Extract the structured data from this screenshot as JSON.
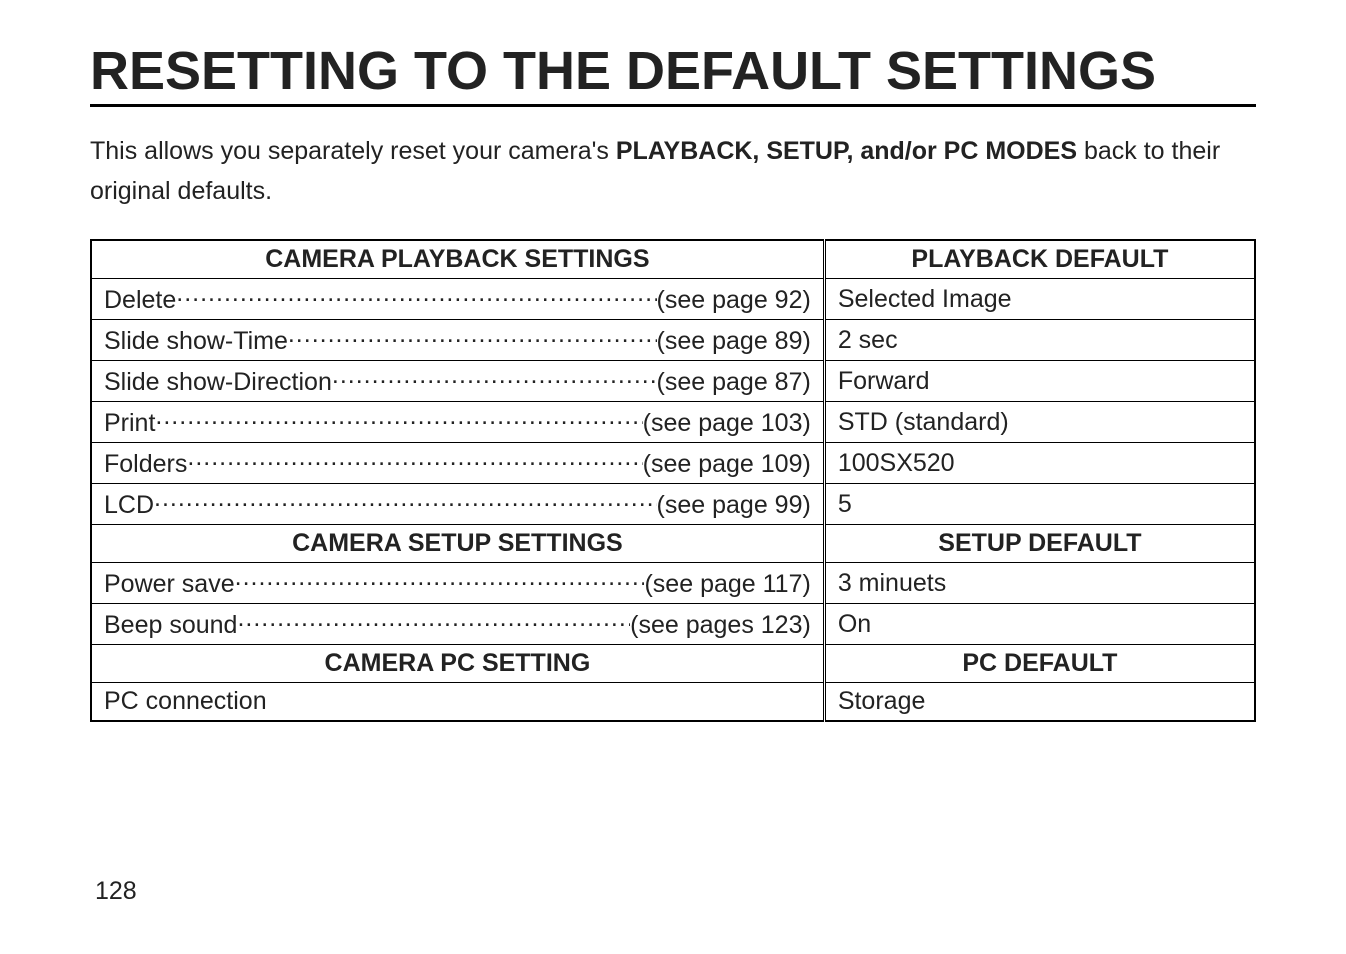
{
  "page_title": "RESETTING TO THE DEFAULT SETTINGS",
  "intro_pre": "This allows you separately reset your camera's ",
  "intro_bold": "PLAYBACK, SETUP, and/or PC MODES",
  "intro_post": " back to their original defaults.",
  "headers": {
    "playback_settings": "CAMERA PLAYBACK SETTINGS",
    "playback_default": "PLAYBACK DEFAULT",
    "setup_settings": "CAMERA SETUP SETTINGS",
    "setup_default": "SETUP DEFAULT",
    "pc_setting": "CAMERA PC SETTING",
    "pc_default": "PC DEFAULT"
  },
  "playback_rows": [
    {
      "label": "Delete ",
      "ref": "(see page 92)",
      "default": "Selected Image"
    },
    {
      "label": "Slide show-Time ",
      "ref": "(see page 89)",
      "default": "2 sec"
    },
    {
      "label": "Slide show-Direction ",
      "ref": "(see page 87)",
      "default": "Forward"
    },
    {
      "label": "Print ",
      "ref": "(see page 103)",
      "default": "STD (standard)"
    },
    {
      "label": "Folders ",
      "ref": "(see page 109)",
      "default": "100SX520"
    },
    {
      "label": "LCD ",
      "ref": "(see page 99)",
      "default": "5"
    }
  ],
  "setup_rows": [
    {
      "label": "Power save ",
      "ref": "(see page 117)",
      "default": "3 minuets"
    },
    {
      "label": "Beep sound ",
      "ref": "(see pages 123)",
      "default": "On"
    }
  ],
  "pc_rows": [
    {
      "label": "PC connection",
      "ref": "",
      "default": "Storage"
    }
  ],
  "page_number": "128",
  "chart_data": {
    "type": "table",
    "title": "RESETTING TO THE DEFAULT SETTINGS",
    "sections": [
      {
        "columns": [
          "CAMERA PLAYBACK SETTINGS",
          "PLAYBACK DEFAULT"
        ],
        "rows": [
          [
            "Delete (see page 92)",
            "Selected Image"
          ],
          [
            "Slide show-Time (see page 89)",
            "2 sec"
          ],
          [
            "Slide show-Direction (see page 87)",
            "Forward"
          ],
          [
            "Print (see page 103)",
            "STD (standard)"
          ],
          [
            "Folders (see page 109)",
            "100SX520"
          ],
          [
            "LCD (see page 99)",
            "5"
          ]
        ]
      },
      {
        "columns": [
          "CAMERA SETUP SETTINGS",
          "SETUP DEFAULT"
        ],
        "rows": [
          [
            "Power save (see page 117)",
            "3 minuets"
          ],
          [
            "Beep sound (see pages 123)",
            "On"
          ]
        ]
      },
      {
        "columns": [
          "CAMERA PC SETTING",
          "PC DEFAULT"
        ],
        "rows": [
          [
            "PC connection",
            "Storage"
          ]
        ]
      }
    ]
  }
}
